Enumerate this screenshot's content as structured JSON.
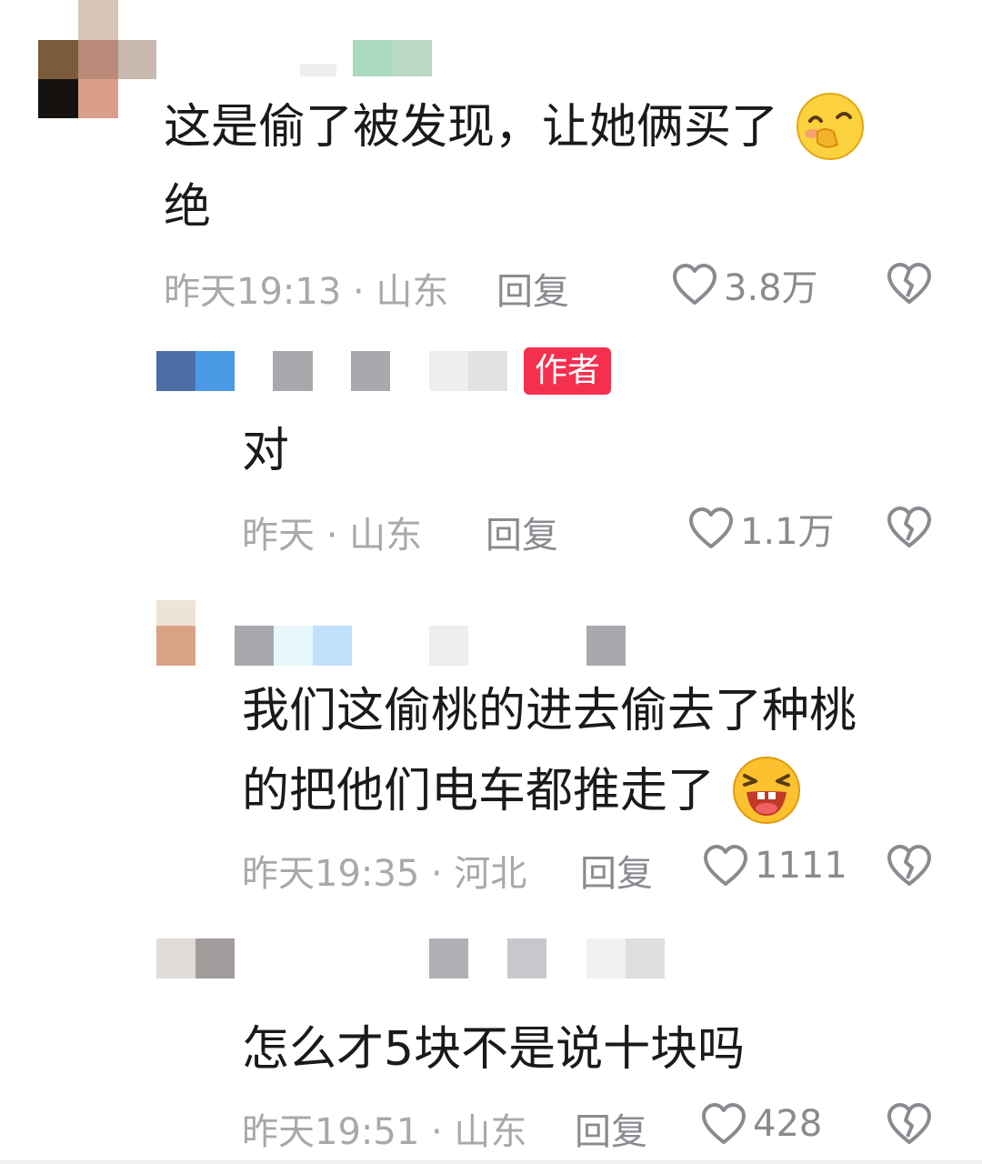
{
  "comments": [
    {
      "text_line1": "这是偷了被发现，让她俩买了",
      "text_line2": "绝",
      "meta": "昨天19:13 · 山东",
      "reply_label": "回复",
      "likes": "3.8万",
      "emoji": "shy-face-emoji"
    },
    {
      "badge": "作者",
      "text": "对",
      "meta": "昨天 · 山东",
      "reply_label": "回复",
      "likes": "1.1万"
    },
    {
      "text_line1": "我们这偷桃的进去偷去了种桃",
      "text_line2": "的把他们电车都推走了",
      "meta": "昨天19:35 · 河北",
      "reply_label": "回复",
      "likes": "1111",
      "emoji": "laughing-face-emoji"
    },
    {
      "text": "怎么才5块不是说十块吗",
      "meta": "昨天19:51 · 山东",
      "reply_label": "回复",
      "likes": "428"
    }
  ],
  "colors": {
    "meta": "#a8a8ad",
    "author_badge": "#f5304f",
    "text": "#1a1a1a"
  },
  "icons": {
    "like": "heart-outline-icon",
    "dislike": "broken-heart-icon"
  }
}
